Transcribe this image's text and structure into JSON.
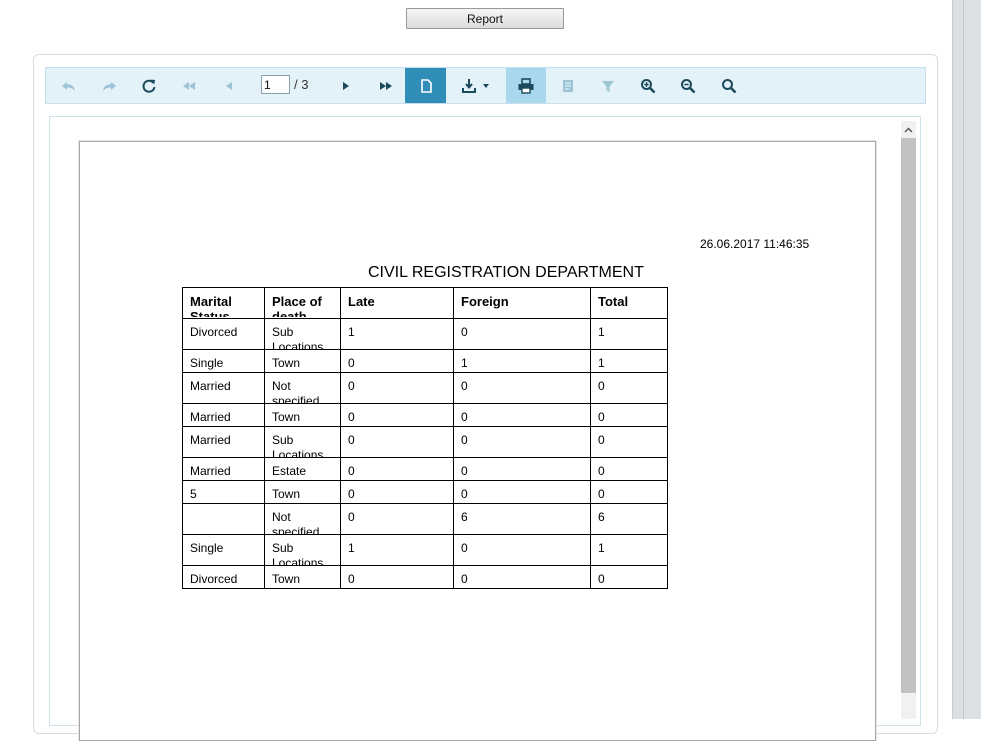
{
  "report_button": {
    "label": "Report"
  },
  "toolbar": {
    "buttons": [
      {
        "name": "undo-icon"
      },
      {
        "name": "redo-icon"
      },
      {
        "name": "refresh-icon"
      },
      {
        "name": "first-page-icon"
      },
      {
        "name": "previous-page-icon"
      },
      {
        "name": "next-page-icon"
      },
      {
        "name": "last-page-icon"
      },
      {
        "name": "page-view-icon"
      },
      {
        "name": "export-icon"
      },
      {
        "name": "print-icon"
      },
      {
        "name": "document-map-icon"
      },
      {
        "name": "filter-icon"
      },
      {
        "name": "zoom-in-icon"
      },
      {
        "name": "zoom-out-icon"
      },
      {
        "name": "find-icon"
      }
    ],
    "page_input": "1",
    "page_of": "/ 3",
    "colors": {
      "bg": "#e3f1f8",
      "active": "#2f8db8",
      "highlight": "#a9d7ee",
      "icon": "#1a4a5c",
      "disabled": "#9cc4d6"
    }
  },
  "report": {
    "timestamp": "26.06.2017 11:46:35",
    "title": "CIVIL REGISTRATION DEPARTMENT",
    "headers": [
      "Marital Status",
      "Place of death",
      "Late",
      "Foreign",
      "Total"
    ],
    "rows": [
      [
        "Divorced",
        "Sub Locations",
        "1",
        "0",
        "1"
      ],
      [
        "Single",
        "Town",
        "0",
        "1",
        "1"
      ],
      [
        "Married",
        "Not specified",
        "0",
        "0",
        "0"
      ],
      [
        "Married",
        "Town",
        "0",
        "0",
        "0"
      ],
      [
        "Married",
        "Sub Locations",
        "0",
        "0",
        "0"
      ],
      [
        "Married",
        "Estate",
        "0",
        "0",
        "0"
      ],
      [
        "5",
        "Town",
        "0",
        "0",
        "0"
      ],
      [
        "",
        "Not specified",
        "0",
        "6",
        "6"
      ],
      [
        "Single",
        "Sub Locations",
        "1",
        "0",
        "1"
      ],
      [
        "Divorced",
        "Town",
        "0",
        "0",
        "0"
      ]
    ]
  }
}
